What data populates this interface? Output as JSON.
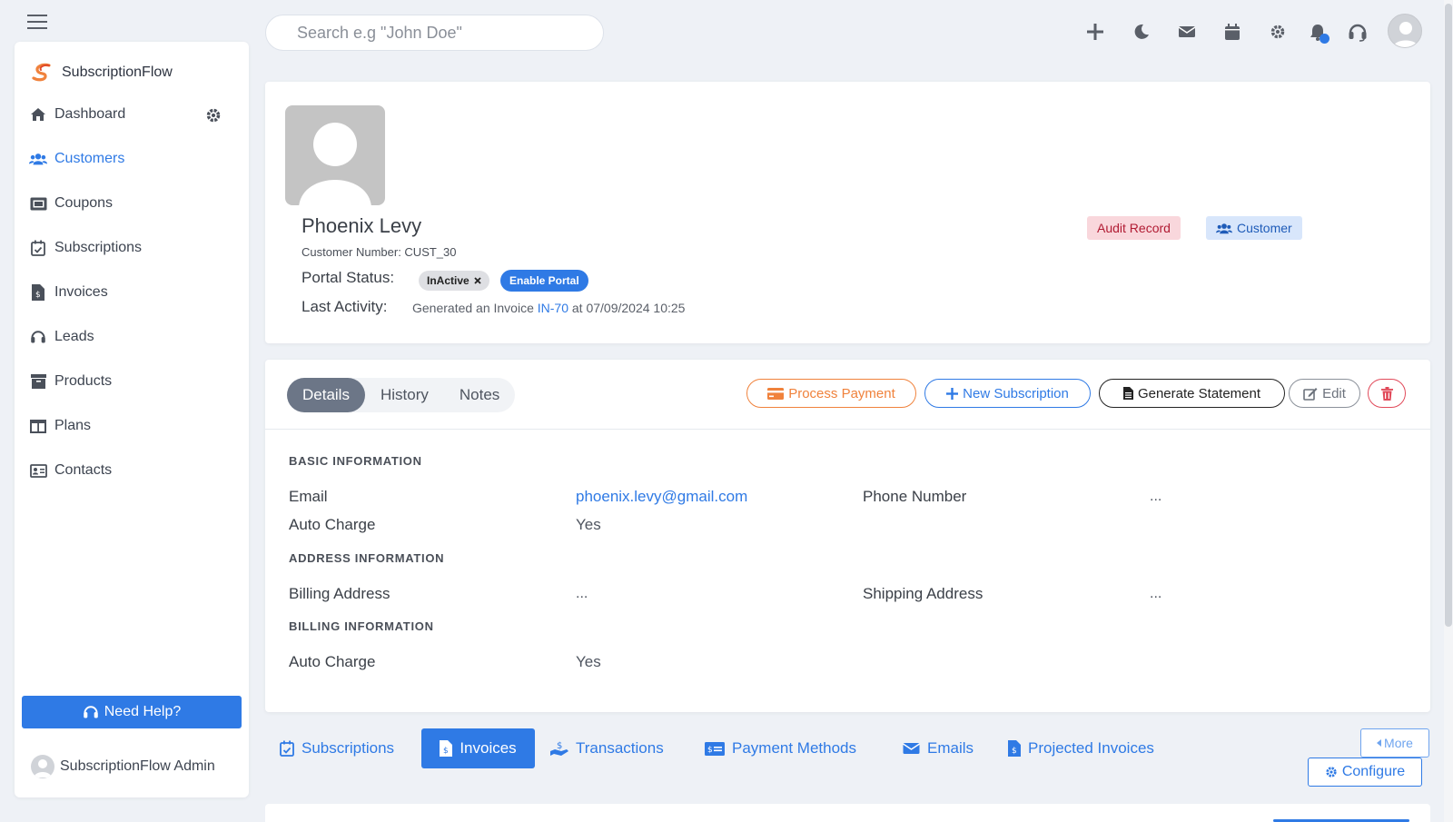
{
  "search": {
    "placeholder": "Search e.g \"John Doe\""
  },
  "sidebar": {
    "brand": "SubscriptionFlow",
    "items": [
      {
        "label": "Dashboard",
        "icon": "home-icon"
      },
      {
        "label": "Customers",
        "icon": "users-icon"
      },
      {
        "label": "Coupons",
        "icon": "ticket-icon"
      },
      {
        "label": "Subscriptions",
        "icon": "calendar-check-icon"
      },
      {
        "label": "Invoices",
        "icon": "invoice-icon"
      },
      {
        "label": "Leads",
        "icon": "headset-icon"
      },
      {
        "label": "Products",
        "icon": "archive-icon"
      },
      {
        "label": "Plans",
        "icon": "columns-icon"
      },
      {
        "label": "Contacts",
        "icon": "contact-card-icon"
      }
    ],
    "active": "Customers",
    "help_label": "Need Help?",
    "admin_label": "SubscriptionFlow Admin"
  },
  "profile": {
    "name": "Phoenix Levy",
    "customer_number": "Customer Number: CUST_30",
    "portal_status_label": "Portal Status:",
    "portal_status": "InActive",
    "enable_portal": "Enable Portal",
    "last_activity_label": "Last Activity:",
    "activity_prefix": "Generated an Invoice ",
    "activity_link": "IN-70",
    "activity_suffix": " at 07/09/2024 10:25",
    "audit_badge": "Audit Record",
    "customer_badge": "Customer"
  },
  "details": {
    "tabs": [
      "Details",
      "History",
      "Notes"
    ],
    "actions": {
      "process_payment": "Process Payment",
      "new_subscription": "New Subscription",
      "generate_statement": "Generate Statement",
      "edit": "Edit"
    },
    "sections": {
      "basic": "BASIC INFORMATION",
      "address": "ADDRESS INFORMATION",
      "billing": "BILLING INFORMATION"
    },
    "fields": {
      "email_label": "Email",
      "email_value": "phoenix.levy@gmail.com",
      "phone_label": "Phone Number",
      "phone_value": "...",
      "auto_charge_label": "Auto Charge",
      "auto_charge_value": "Yes",
      "billing_address_label": "Billing Address",
      "billing_address_value": "...",
      "shipping_address_label": "Shipping Address",
      "shipping_address_value": "...",
      "billing_auto_charge_label": "Auto Charge",
      "billing_auto_charge_value": "Yes"
    }
  },
  "bottom_tabs": [
    "Subscriptions",
    "Invoices",
    "Transactions",
    "Payment Methods",
    "Emails",
    "Projected Invoices"
  ],
  "more_label": "More",
  "configure_label": "Configure",
  "colors": {
    "primary": "#2f7ae5",
    "orange": "#f0823c",
    "danger": "#e14a5a",
    "audit_bg": "#f9d7dc",
    "customer_bg": "#d8e6fb"
  }
}
